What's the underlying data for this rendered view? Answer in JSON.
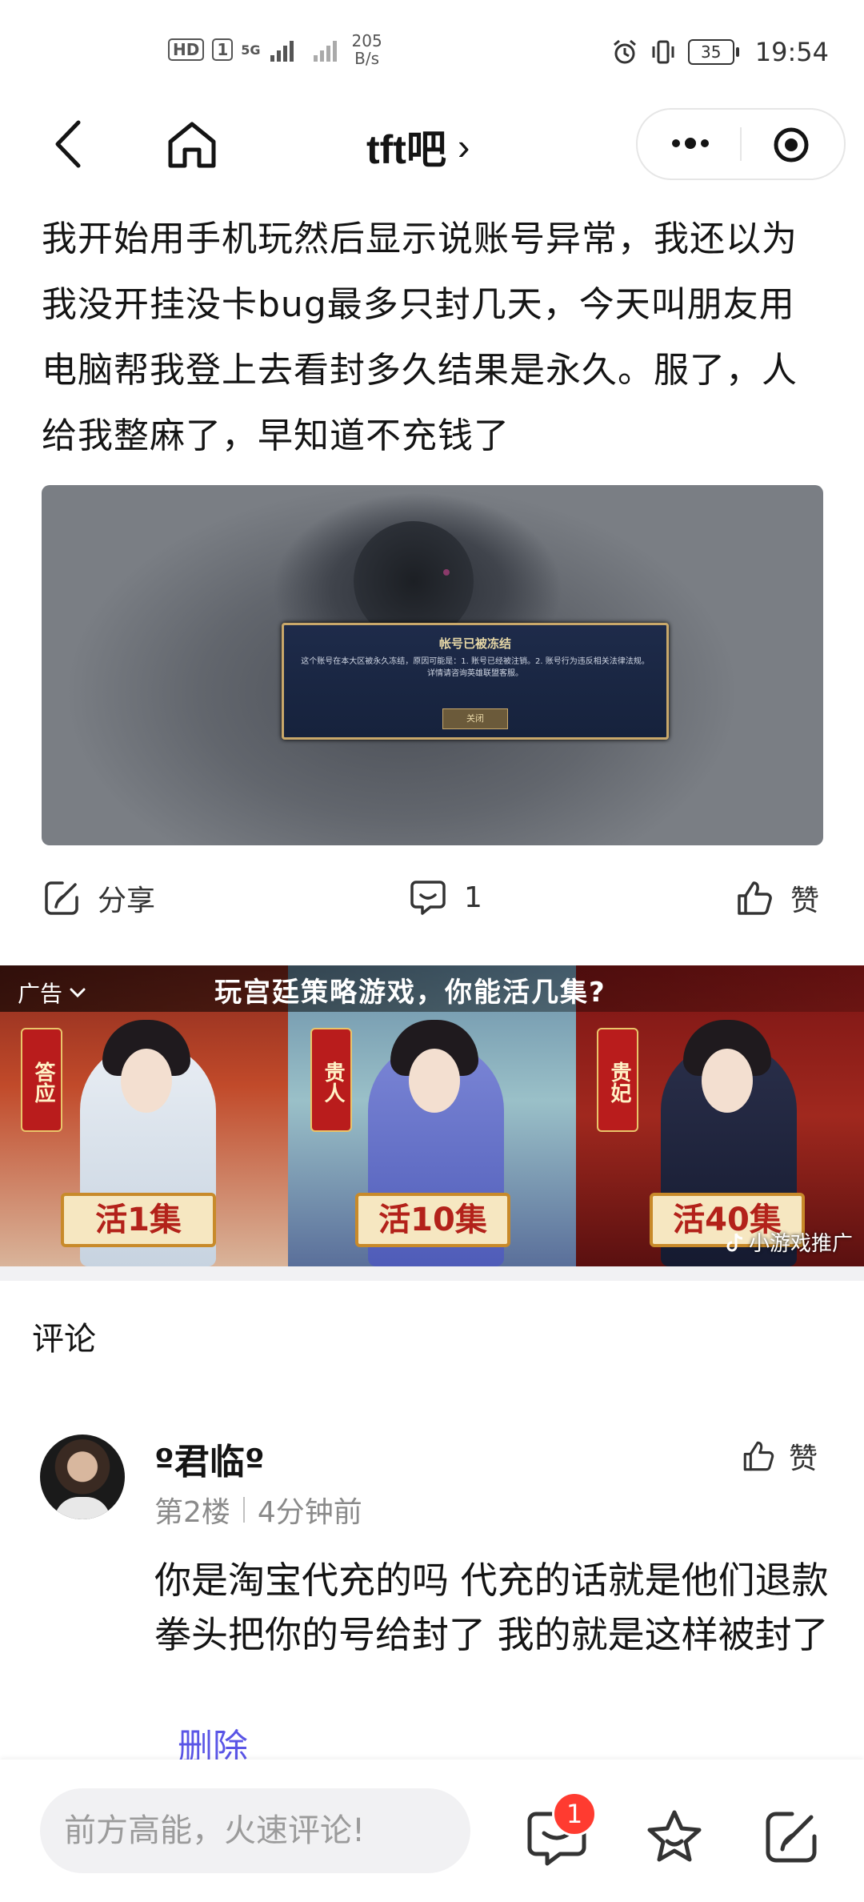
{
  "status_bar": {
    "network_badge": "HD",
    "sim_badge": "1",
    "signal_label": "5G",
    "data_rate_value": "205",
    "data_rate_unit": "B/s",
    "battery": "35",
    "time": "19:54"
  },
  "nav": {
    "title": "tft吧",
    "title_chevron": "›"
  },
  "post": {
    "text": "我开始用手机玩然后显示说账号异常，我还以为我没开挂没卡bug最多只封几天，今天叫朋友用电脑帮我登上去看封多久结果是永久。服了，人给我整麻了，早知道不充钱了",
    "image": {
      "dialog_title": "帐号已被冻结",
      "dialog_body": "这个账号在本大区被永久冻结，原因可能是：1. 账号已经被注销。2. 账号行为违反相关法律法规。详情请咨询英雄联盟客服。",
      "dialog_button": "关闭"
    }
  },
  "actions": {
    "share_label": "分享",
    "comment_count": "1",
    "like_label": "赞"
  },
  "ad": {
    "label": "广告",
    "headline": "玩宫廷策略游戏，你能活几集?",
    "panels": [
      {
        "rank": "答应",
        "plate": "活1集"
      },
      {
        "rank": "贵人",
        "plate": "活10集"
      },
      {
        "rank": "贵妃",
        "plate": "活40集"
      }
    ],
    "source": "小游戏推广"
  },
  "comments": {
    "header": "评论",
    "items": [
      {
        "user": "º君临º",
        "floor": "第2楼",
        "time": "4分钟前",
        "like_label": "赞",
        "text": "你是淘宝代充的吗 代充的话就是他们退款 拳头把你的号给封了 我的就是这样被封了",
        "delete_label": "删除"
      }
    ]
  },
  "bottom_bar": {
    "placeholder": "前方高能，火速评论!",
    "comment_badge": "1"
  },
  "colors": {
    "accent_link": "#5a55e6",
    "badge_red": "#ff3b30",
    "input_bg": "#f1f1f3"
  },
  "icons": [
    "back-icon",
    "home-icon",
    "more-icon",
    "target-icon",
    "share-icon",
    "comment-icon",
    "thumb-up-icon",
    "chevron-down-icon",
    "comment-bubble-icon",
    "star-icon",
    "edit-icon"
  ]
}
